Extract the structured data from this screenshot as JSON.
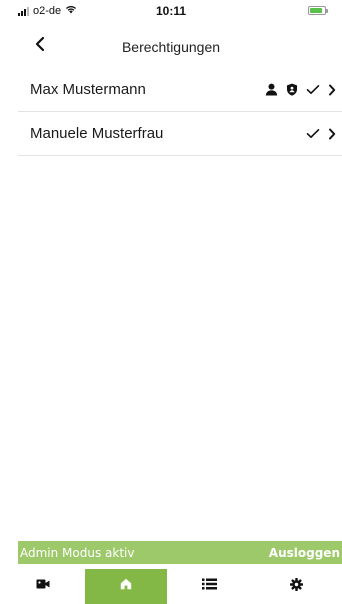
{
  "status_bar": {
    "carrier": "o2-de",
    "time": "10:11"
  },
  "nav": {
    "title": "Berechtigungen",
    "back_icon": "chevron-left-icon"
  },
  "permissions": [
    {
      "name": "Max Mustermann",
      "icons": [
        "person-icon",
        "shield-icon",
        "checkmark-icon",
        "chevron-right-icon"
      ]
    },
    {
      "name": "Manuele Musterfrau",
      "icons": [
        "checkmark-icon",
        "chevron-right-icon"
      ]
    }
  ],
  "admin_banner": {
    "text": "Admin Modus aktiv",
    "logout_label": "Ausloggen"
  },
  "tabs": [
    {
      "icon": "video-camera-icon",
      "active": false
    },
    {
      "icon": "home-icon",
      "active": true
    },
    {
      "icon": "list-icon",
      "active": false
    },
    {
      "icon": "gear-icon",
      "active": false
    }
  ],
  "colors": {
    "accent": "#84b846",
    "banner": "#9dc96b",
    "nav_text": "#222222"
  }
}
